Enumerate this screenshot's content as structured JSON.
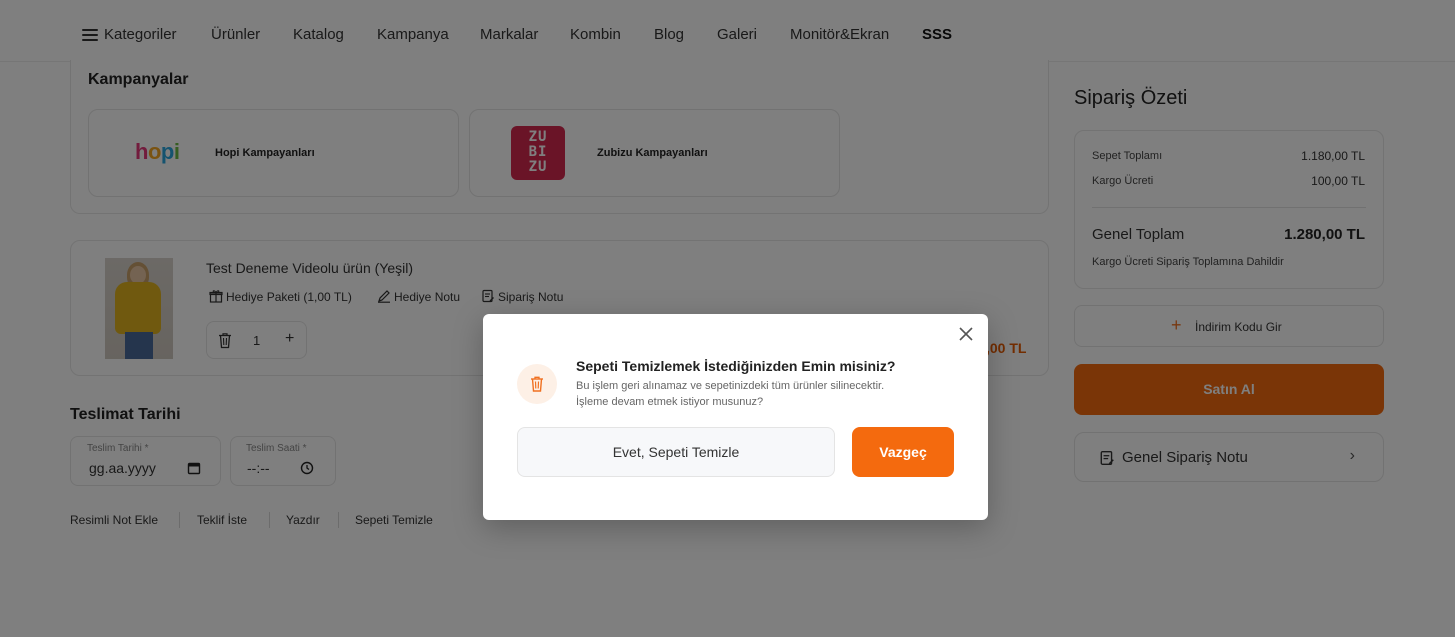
{
  "nav": {
    "items": [
      "Kategoriler",
      "Ürünler",
      "Katalog",
      "Kampanya",
      "Markalar",
      "Kombin",
      "Blog",
      "Galeri",
      "Monitör&Ekran",
      "SSS"
    ]
  },
  "campaigns": {
    "title": "Kampanyalar",
    "items": [
      {
        "logo_text": "hopi",
        "label": "Hopi Kampayanları"
      },
      {
        "logo_text": "ZU BI ZU",
        "label": "Zubizu Kampayanları"
      }
    ]
  },
  "cart": {
    "product_title": "Test Deneme Videolu ürün  (Yeşil)",
    "options": [
      "Hediye Paketi (1,00 TL)",
      "Hediye Notu",
      "Sipariş Notu"
    ],
    "quantity": "1",
    "price_partial": ",00 TL"
  },
  "delivery": {
    "title": "Teslimat Tarihi",
    "date_label": "Teslim Tarihi *",
    "date_placeholder": "gg.aa.yyyy",
    "time_label": "Teslim Saati *",
    "time_placeholder": "--:--"
  },
  "bottom_links": [
    "Resimli Not Ekle",
    "Teklif İste",
    "Yazdır",
    "Sepeti Temizle"
  ],
  "summary": {
    "title": "Sipariş Özeti",
    "cart_total_label": "Sepet Toplamı",
    "cart_total": "1.180,00 TL",
    "shipping_label": "Kargo Ücreti",
    "shipping": "100,00 TL",
    "grand_total_label": "Genel Toplam",
    "grand_total": "1.280,00 TL",
    "shipping_note": "Kargo Ücreti Sipariş Toplamına Dahildir",
    "discount_label": "İndirim Kodu Gir",
    "buy_label": "Satın Al",
    "order_note_label": "Genel Sipariş Notu"
  },
  "modal": {
    "title": "Sepeti Temizlemek İstediğinizden Emin misiniz?",
    "desc_line1": "Bu işlem geri alınamaz ve sepetinizdeki tüm ürünler silinecektir.",
    "desc_line2": "İşleme devam etmek istiyor musunuz?",
    "confirm_label": "Evet, Sepeti Temizle",
    "cancel_label": "Vazgeç"
  },
  "colors": {
    "accent": "#f46a0e",
    "zubizu": "#d4284f"
  }
}
